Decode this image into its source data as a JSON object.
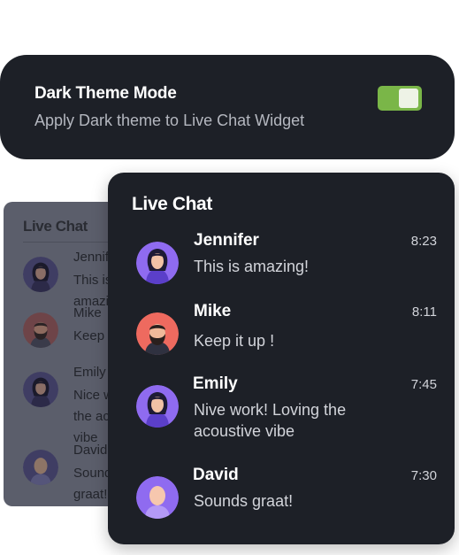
{
  "settings": {
    "title": "Dark Theme Mode",
    "subtitle": "Apply Dark theme to Live Chat Widget",
    "toggle_on": true,
    "toggle_color": "#7ab648"
  },
  "preview_light": {
    "title": "Live Chat",
    "items": [
      {
        "name": "Jennifer",
        "message": "This is amazing!"
      },
      {
        "name": "Mike",
        "message": "Keep it up !"
      },
      {
        "name": "Emily",
        "message": "Nice work! Loving the acoustive vibe"
      },
      {
        "name": "David",
        "message": "Sounds graat!"
      }
    ]
  },
  "chat": {
    "title": "Live Chat",
    "items": [
      {
        "name": "Jennifer",
        "message": "This is amazing!",
        "time": "8:23",
        "avatar": "female-avatar-icon",
        "avatar_color": "#8f6bf0"
      },
      {
        "name": "Mike",
        "message": "Keep it up !",
        "time": "8:11",
        "avatar": "male-bearded-avatar-icon",
        "avatar_color": "#ee6a5f"
      },
      {
        "name": "Emily",
        "message": "Nive work! Loving the acoustive vibe",
        "time": "7:45",
        "avatar": "female-avatar-icon",
        "avatar_color": "#8f6bf0"
      },
      {
        "name": "David",
        "message": "Sounds graat!",
        "time": "7:30",
        "avatar": "bald-avatar-icon",
        "avatar_color": "#8f6bf0"
      }
    ]
  },
  "colors": {
    "background": "#ffffff",
    "card": "#1d2027",
    "accent_purple": "#8f6bf0",
    "accent_red": "#ee6a5f"
  }
}
